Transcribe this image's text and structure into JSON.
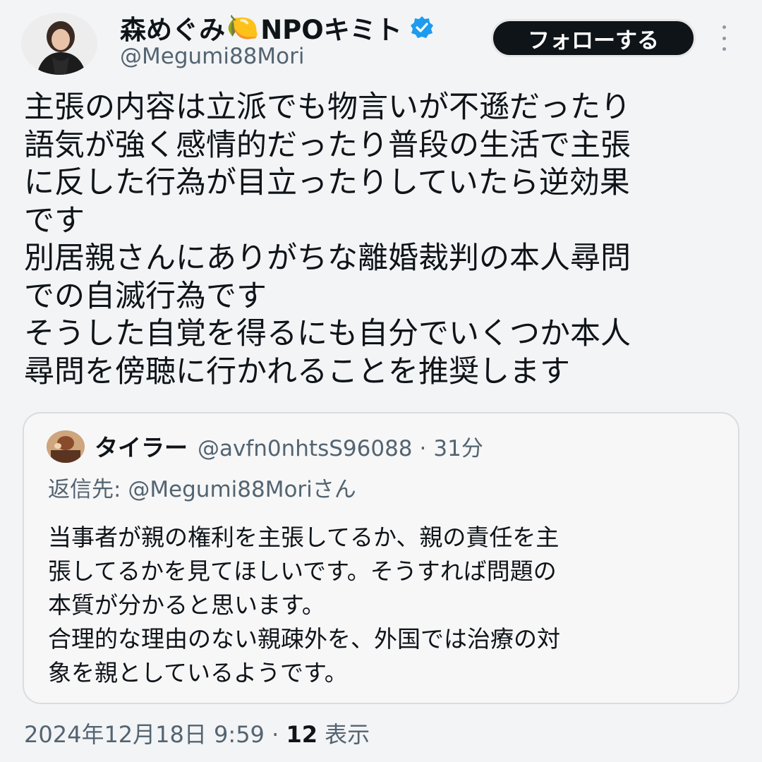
{
  "author": {
    "name": "森めぐみ",
    "name_suffix": "NPOキミト",
    "lemon_emoji": "🍋",
    "handle": "@Megumi88Mori",
    "verified": true,
    "verified_color": "#1d9bf0"
  },
  "follow_button": {
    "label": "フォローする"
  },
  "more_icon": "more-vertical-icon",
  "tweet": {
    "lines": [
      "主張の内容は立派でも物言いが不遜だったり",
      "語気が強く感情的だったり普段の生活で主張",
      "に反した行為が目立ったりしていたら逆効果",
      "です",
      "別居親さんにありがちな離婚裁判の本人尋問",
      "での自滅行為です",
      "そうした自覚を得るにも自分でいくつか本人",
      "尋問を傍聴に行かれることを推奨します"
    ]
  },
  "quote": {
    "author_name": "タイラー",
    "handle": "@avfn0nhtsS96088",
    "time_sep": "·",
    "time": "31分",
    "reply_prefix": "返信先: ",
    "reply_to": "@Megumi88Moriさん",
    "lines": [
      "当事者が親の権利を主張してるか、親の責任を主",
      "張してるかを見てほしいです。そうすれば問題の",
      "本質が分かると思います。",
      "合理的な理由のない親疎外を、外国では治療の対",
      "象を親としているようです。"
    ]
  },
  "footer": {
    "date": "2024年12月18日 9:59",
    "sep": "·",
    "views_count": "12",
    "views_label": "表示"
  }
}
